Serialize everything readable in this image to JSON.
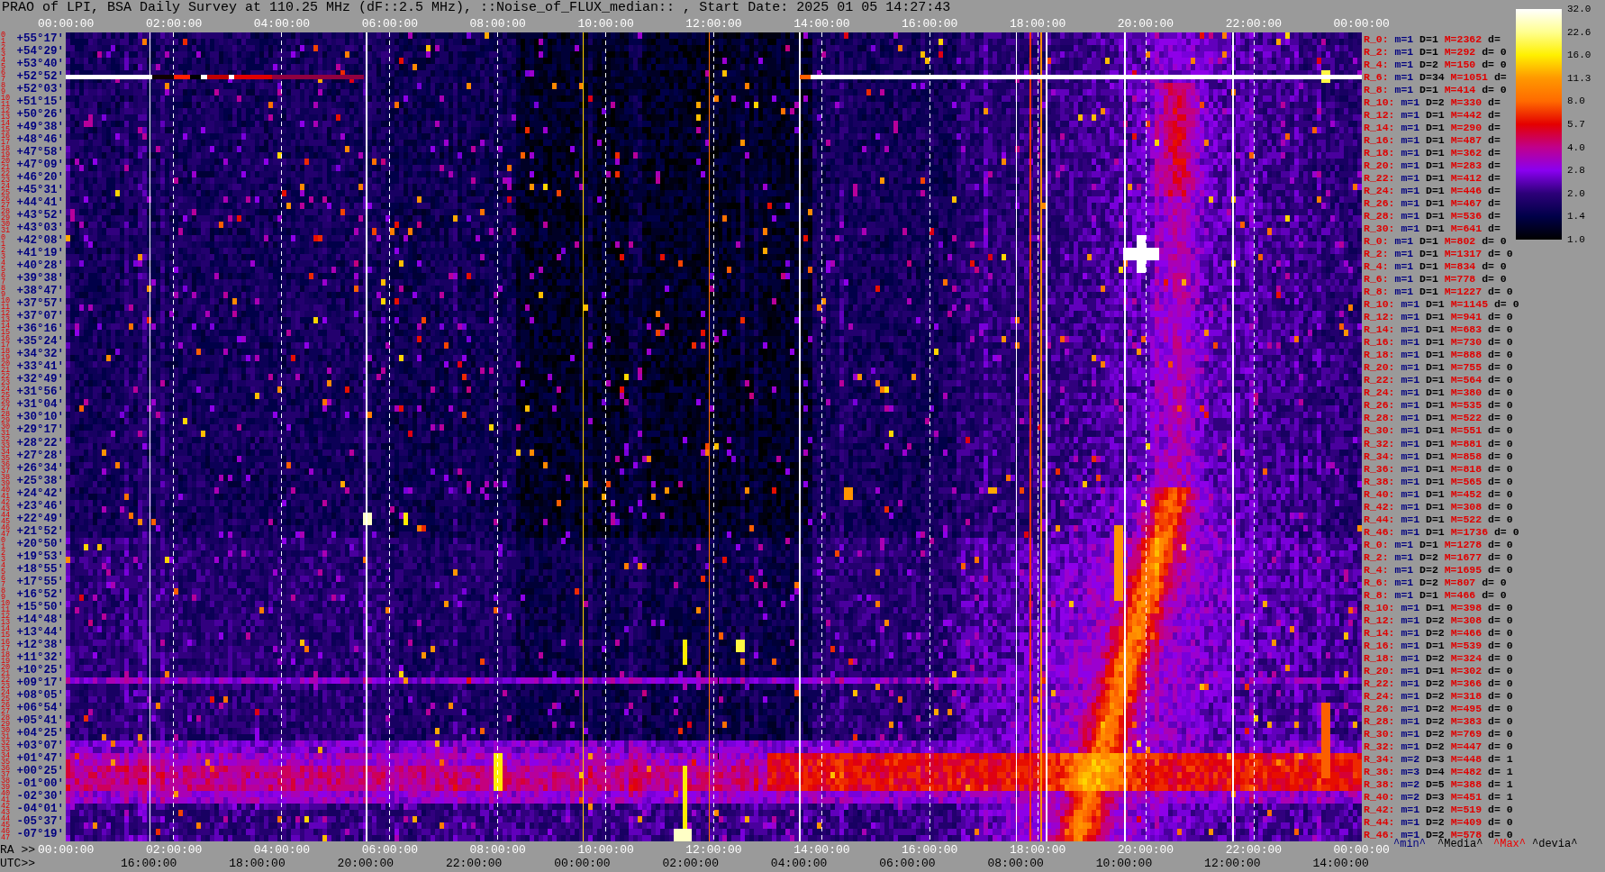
{
  "title": "PRAO of LPI, BSA Daily Survey at 110.25 MHz (dF::2.5 MHz), ::Noise_of_FLUX_median:: , Start Date: 2025 01 05 14:27:43",
  "top_axis": {
    "labels": [
      "00:00:00",
      "02:00:00",
      "04:00:00",
      "06:00:00",
      "08:00:00",
      "10:00:00",
      "12:00:00",
      "14:00:00",
      "16:00:00",
      "18:00:00",
      "20:00:00",
      "22:00:00",
      "00:00:00"
    ]
  },
  "declination_axis": {
    "beam_numbers": [
      "0",
      "1",
      "2",
      "3",
      "4",
      "5",
      "6",
      "7",
      "8",
      "9",
      "10",
      "11",
      "12",
      "13",
      "14",
      "15",
      "16",
      "17",
      "18",
      "19",
      "20",
      "21",
      "22",
      "23",
      "24",
      "25",
      "26",
      "27",
      "28",
      "29",
      "30",
      "31",
      "0",
      "1",
      "2",
      "3",
      "4",
      "5",
      "6",
      "7",
      "8",
      "9",
      "10",
      "11",
      "12",
      "13",
      "14",
      "15",
      "16",
      "17",
      "18",
      "19",
      "20",
      "21",
      "22",
      "23",
      "24",
      "25",
      "26",
      "27",
      "28",
      "29",
      "30",
      "31",
      "32",
      "33",
      "34",
      "35",
      "36",
      "37",
      "38",
      "39",
      "40",
      "41",
      "42",
      "43",
      "44",
      "45",
      "46",
      "47",
      "0",
      "1",
      "2",
      "3",
      "4",
      "5",
      "6",
      "7",
      "8",
      "9",
      "10",
      "11",
      "12",
      "13",
      "14",
      "15",
      "16",
      "17",
      "18",
      "19",
      "20",
      "21",
      "22",
      "23",
      "24",
      "25",
      "26",
      "27",
      "28",
      "29",
      "30",
      "31",
      "32",
      "33",
      "34",
      "35",
      "36",
      "37",
      "38",
      "39",
      "40",
      "41",
      "42",
      "43",
      "44",
      "45",
      "46",
      "47"
    ],
    "labels": [
      "+55°17'",
      "+54°29'",
      "+53°40'",
      "+52°52'",
      "+52°03'",
      "+51°15'",
      "+50°26'",
      "+49°38'",
      "+48°46'",
      "+47°58'",
      "+47°09'",
      "+46°20'",
      "+45°31'",
      "+44°41'",
      "+43°52'",
      "+43°03'",
      "+42°08'",
      "+41°19'",
      "+40°28'",
      "+39°38'",
      "+38°47'",
      "+37°57'",
      "+37°07'",
      "+36°16'",
      "+35°24'",
      "+34°32'",
      "+33°41'",
      "+32°49'",
      "+31°56'",
      "+31°04'",
      "+30°10'",
      "+29°17'",
      "+28°22'",
      "+27°28'",
      "+26°34'",
      "+25°38'",
      "+24°42'",
      "+23°46'",
      "+22°49'",
      "+21°52'",
      "+20°50'",
      "+19°53'",
      "+18°55'",
      "+17°55'",
      "+16°52'",
      "+15°50'",
      "+14°48'",
      "+13°44'",
      "+12°38'",
      "+11°32'",
      "+10°25'",
      "+09°17'",
      "+08°05'",
      "+06°54'",
      "+05°41'",
      "+04°25'",
      "+03°07'",
      "+01°47'",
      "+00°25'",
      "-01°00'",
      "-02°30'",
      "-04°01'",
      "-05°37'",
      "-07°19'"
    ]
  },
  "beam_stats": [
    {
      "beam": "R_0:",
      "m": "m=1",
      "D": "D=1",
      "M": "M=2362",
      "d": "d="
    },
    {
      "beam": "R_2:",
      "m": "m=1",
      "D": "D=1",
      "M": "M=292",
      "d": "d= 0"
    },
    {
      "beam": "R_4:",
      "m": "m=1",
      "D": "D=2",
      "M": "M=150",
      "d": "d= 0"
    },
    {
      "beam": "R_6:",
      "m": "m=1",
      "D": "D=34",
      "M": "M=1051",
      "d": "d="
    },
    {
      "beam": "R_8:",
      "m": "m=1",
      "D": "D=1",
      "M": "M=414",
      "d": "d= 0"
    },
    {
      "beam": "R_10:",
      "m": "m=1",
      "D": "D=2",
      "M": "M=330",
      "d": "d="
    },
    {
      "beam": "R_12:",
      "m": "m=1",
      "D": "D=1",
      "M": "M=442",
      "d": "d="
    },
    {
      "beam": "R_14:",
      "m": "m=1",
      "D": "D=1",
      "M": "M=290",
      "d": "d="
    },
    {
      "beam": "R_16:",
      "m": "m=1",
      "D": "D=1",
      "M": "M=487",
      "d": "d="
    },
    {
      "beam": "R_18:",
      "m": "m=1",
      "D": "D=1",
      "M": "M=362",
      "d": "d="
    },
    {
      "beam": "R_20:",
      "m": "m=1",
      "D": "D=1",
      "M": "M=283",
      "d": "d="
    },
    {
      "beam": "R_22:",
      "m": "m=1",
      "D": "D=1",
      "M": "M=412",
      "d": "d="
    },
    {
      "beam": "R_24:",
      "m": "m=1",
      "D": "D=1",
      "M": "M=446",
      "d": "d="
    },
    {
      "beam": "R_26:",
      "m": "m=1",
      "D": "D=1",
      "M": "M=467",
      "d": "d="
    },
    {
      "beam": "R_28:",
      "m": "m=1",
      "D": "D=1",
      "M": "M=536",
      "d": "d="
    },
    {
      "beam": "R_30:",
      "m": "m=1",
      "D": "D=1",
      "M": "M=641",
      "d": "d="
    },
    {
      "beam": "R_0:",
      "m": "m=1",
      "D": "D=1",
      "M": "M=802",
      "d": "d= 0"
    },
    {
      "beam": "R_2:",
      "m": "m=1",
      "D": "D=1",
      "M": "M=1317",
      "d": "d= 0"
    },
    {
      "beam": "R_4:",
      "m": "m=1",
      "D": "D=1",
      "M": "M=834",
      "d": "d= 0"
    },
    {
      "beam": "R_6:",
      "m": "m=1",
      "D": "D=1",
      "M": "M=778",
      "d": "d= 0"
    },
    {
      "beam": "R_8:",
      "m": "m=1",
      "D": "D=1",
      "M": "M=1227",
      "d": "d= 0"
    },
    {
      "beam": "R_10:",
      "m": "m=1",
      "D": "D=1",
      "M": "M=1145",
      "d": "d= 0"
    },
    {
      "beam": "R_12:",
      "m": "m=1",
      "D": "D=1",
      "M": "M=941",
      "d": "d= 0"
    },
    {
      "beam": "R_14:",
      "m": "m=1",
      "D": "D=1",
      "M": "M=683",
      "d": "d= 0"
    },
    {
      "beam": "R_16:",
      "m": "m=1",
      "D": "D=1",
      "M": "M=730",
      "d": "d= 0"
    },
    {
      "beam": "R_18:",
      "m": "m=1",
      "D": "D=1",
      "M": "M=888",
      "d": "d= 0"
    },
    {
      "beam": "R_20:",
      "m": "m=1",
      "D": "D=1",
      "M": "M=755",
      "d": "d= 0"
    },
    {
      "beam": "R_22:",
      "m": "m=1",
      "D": "D=1",
      "M": "M=564",
      "d": "d= 0"
    },
    {
      "beam": "R_24:",
      "m": "m=1",
      "D": "D=1",
      "M": "M=380",
      "d": "d= 0"
    },
    {
      "beam": "R_26:",
      "m": "m=1",
      "D": "D=1",
      "M": "M=535",
      "d": "d= 0"
    },
    {
      "beam": "R_28:",
      "m": "m=1",
      "D": "D=1",
      "M": "M=522",
      "d": "d= 0"
    },
    {
      "beam": "R_30:",
      "m": "m=1",
      "D": "D=1",
      "M": "M=551",
      "d": "d= 0"
    },
    {
      "beam": "R_32:",
      "m": "m=1",
      "D": "D=1",
      "M": "M=881",
      "d": "d= 0"
    },
    {
      "beam": "R_34:",
      "m": "m=1",
      "D": "D=1",
      "M": "M=858",
      "d": "d= 0"
    },
    {
      "beam": "R_36:",
      "m": "m=1",
      "D": "D=1",
      "M": "M=818",
      "d": "d= 0"
    },
    {
      "beam": "R_38:",
      "m": "m=1",
      "D": "D=1",
      "M": "M=565",
      "d": "d= 0"
    },
    {
      "beam": "R_40:",
      "m": "m=1",
      "D": "D=1",
      "M": "M=452",
      "d": "d= 0"
    },
    {
      "beam": "R_42:",
      "m": "m=1",
      "D": "D=1",
      "M": "M=308",
      "d": "d= 0"
    },
    {
      "beam": "R_44:",
      "m": "m=1",
      "D": "D=1",
      "M": "M=522",
      "d": "d= 0"
    },
    {
      "beam": "R_46:",
      "m": "m=1",
      "D": "D=1",
      "M": "M=1736",
      "d": "d= 0"
    },
    {
      "beam": "R_0:",
      "m": "m=1",
      "D": "D=1",
      "M": "M=1278",
      "d": "d= 0"
    },
    {
      "beam": "R_2:",
      "m": "m=1",
      "D": "D=2",
      "M": "M=1677",
      "d": "d= 0"
    },
    {
      "beam": "R_4:",
      "m": "m=1",
      "D": "D=2",
      "M": "M=1695",
      "d": "d= 0"
    },
    {
      "beam": "R_6:",
      "m": "m=1",
      "D": "D=2",
      "M": "M=807",
      "d": "d= 0"
    },
    {
      "beam": "R_8:",
      "m": "m=1",
      "D": "D=1",
      "M": "M=466",
      "d": "d= 0"
    },
    {
      "beam": "R_10:",
      "m": "m=1",
      "D": "D=1",
      "M": "M=398",
      "d": "d= 0"
    },
    {
      "beam": "R_12:",
      "m": "m=1",
      "D": "D=2",
      "M": "M=308",
      "d": "d= 0"
    },
    {
      "beam": "R_14:",
      "m": "m=1",
      "D": "D=2",
      "M": "M=466",
      "d": "d= 0"
    },
    {
      "beam": "R_16:",
      "m": "m=1",
      "D": "D=1",
      "M": "M=539",
      "d": "d= 0"
    },
    {
      "beam": "R_18:",
      "m": "m=1",
      "D": "D=2",
      "M": "M=324",
      "d": "d= 0"
    },
    {
      "beam": "R_20:",
      "m": "m=1",
      "D": "D=1",
      "M": "M=302",
      "d": "d= 0"
    },
    {
      "beam": "R_22:",
      "m": "m=1",
      "D": "D=2",
      "M": "M=366",
      "d": "d= 0"
    },
    {
      "beam": "R_24:",
      "m": "m=1",
      "D": "D=2",
      "M": "M=318",
      "d": "d= 0"
    },
    {
      "beam": "R_26:",
      "m": "m=1",
      "D": "D=2",
      "M": "M=495",
      "d": "d= 0"
    },
    {
      "beam": "R_28:",
      "m": "m=1",
      "D": "D=2",
      "M": "M=383",
      "d": "d= 0"
    },
    {
      "beam": "R_30:",
      "m": "m=1",
      "D": "D=2",
      "M": "M=769",
      "d": "d= 0"
    },
    {
      "beam": "R_32:",
      "m": "m=1",
      "D": "D=2",
      "M": "M=447",
      "d": "d= 0"
    },
    {
      "beam": "R_34:",
      "m": "m=2",
      "D": "D=3",
      "M": "M=448",
      "d": "d= 1"
    },
    {
      "beam": "R_36:",
      "m": "m=3",
      "D": "D=4",
      "M": "M=482",
      "d": "d= 1"
    },
    {
      "beam": "R_38:",
      "m": "m=2",
      "D": "D=5",
      "M": "M=388",
      "d": "d= 1"
    },
    {
      "beam": "R_40:",
      "m": "m=2",
      "D": "D=3",
      "M": "M=451",
      "d": "d= 1"
    },
    {
      "beam": "R_42:",
      "m": "m=1",
      "D": "D=2",
      "M": "M=519",
      "d": "d= 0"
    },
    {
      "beam": "R_44:",
      "m": "m=1",
      "D": "D=2",
      "M": "M=409",
      "d": "d= 0"
    },
    {
      "beam": "R_46:",
      "m": "m=1",
      "D": "D=2",
      "M": "M=578",
      "d": "d= 0"
    }
  ],
  "color_scale": {
    "labels": [
      "32.0",
      "22.6",
      "16.0",
      "11.3",
      "8.0",
      "5.7",
      "4.0",
      "2.8",
      "2.0",
      "1.4",
      "1.0"
    ]
  },
  "bottom_axis": {
    "ra_prefix": "RA >>",
    "ra_labels": [
      "00:00:00",
      "02:00:00",
      "04:00:00",
      "06:00:00",
      "08:00:00",
      "10:00:00",
      "12:00:00",
      "14:00:00",
      "16:00:00",
      "18:00:00",
      "20:00:00",
      "22:00:00",
      "00:00:00"
    ],
    "utc_prefix": "UTC>>",
    "utc_labels": [
      "16:00:00",
      "18:00:00",
      "20:00:00",
      "22:00:00",
      "00:00:00",
      "02:00:00",
      "04:00:00",
      "06:00:00",
      "08:00:00",
      "10:00:00",
      "12:00:00",
      "14:00:00"
    ]
  },
  "legend": [
    {
      "text": "^min^",
      "color": "#000080"
    },
    {
      "text": "^Media^",
      "color": "#000000"
    },
    {
      "text": "^Max^",
      "color": "#ee0000"
    },
    {
      "text": "^devia^",
      "color": "#000000"
    }
  ]
}
